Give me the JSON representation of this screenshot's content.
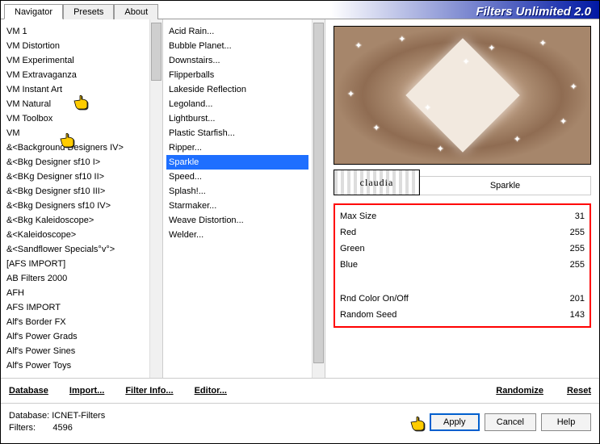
{
  "app_title": "Filters Unlimited 2.0",
  "tabs": [
    "Navigator",
    "Presets",
    "About"
  ],
  "col1": [
    "VM 1",
    "VM Distortion",
    "VM Experimental",
    "VM Extravaganza",
    "VM Instant Art",
    "VM Natural",
    "VM Toolbox",
    "VM",
    "&<Background Designers IV>",
    "&<Bkg Designer sf10 I>",
    "&<BKg Designer sf10 II>",
    "&<Bkg Designer sf10 III>",
    "&<Bkg Designers sf10 IV>",
    "&<Bkg Kaleidoscope>",
    "&<Kaleidoscope>",
    "&<Sandflower Specials°v°>",
    "[AFS IMPORT]",
    "AB Filters 2000",
    "AFH",
    "AFS IMPORT",
    "Alf's Border FX",
    "Alf's Power Grads",
    "Alf's Power Sines",
    "Alf's Power Toys"
  ],
  "col2": [
    "Acid Rain...",
    "Bubble Planet...",
    "Downstairs...",
    "Flipperballs",
    "Lakeside Reflection",
    "Legoland...",
    "Lightburst...",
    "Plastic Starfish...",
    "Ripper...",
    "Sparkle",
    "Speed...",
    "Splash!...",
    "Starmaker...",
    "Weave Distortion...",
    "Welder..."
  ],
  "selected_col2": "Sparkle",
  "watermark": "claudia",
  "filter_name": "Sparkle",
  "params": [
    {
      "label": "Max Size",
      "value": "31"
    },
    {
      "label": "Red",
      "value": "255"
    },
    {
      "label": "Green",
      "value": "255"
    },
    {
      "label": "Blue",
      "value": "255"
    }
  ],
  "params2": [
    {
      "label": "Rnd Color On/Off",
      "value": "201"
    },
    {
      "label": "Random Seed",
      "value": "143"
    }
  ],
  "links": [
    "Database",
    "Import...",
    "Filter Info...",
    "Editor..."
  ],
  "links_right": [
    "Randomize",
    "Reset"
  ],
  "footer": {
    "db_label": "Database:",
    "db": "ICNET-Filters",
    "filters_label": "Filters:",
    "filters": "4596"
  },
  "buttons": {
    "apply": "Apply",
    "cancel": "Cancel",
    "help": "Help"
  }
}
